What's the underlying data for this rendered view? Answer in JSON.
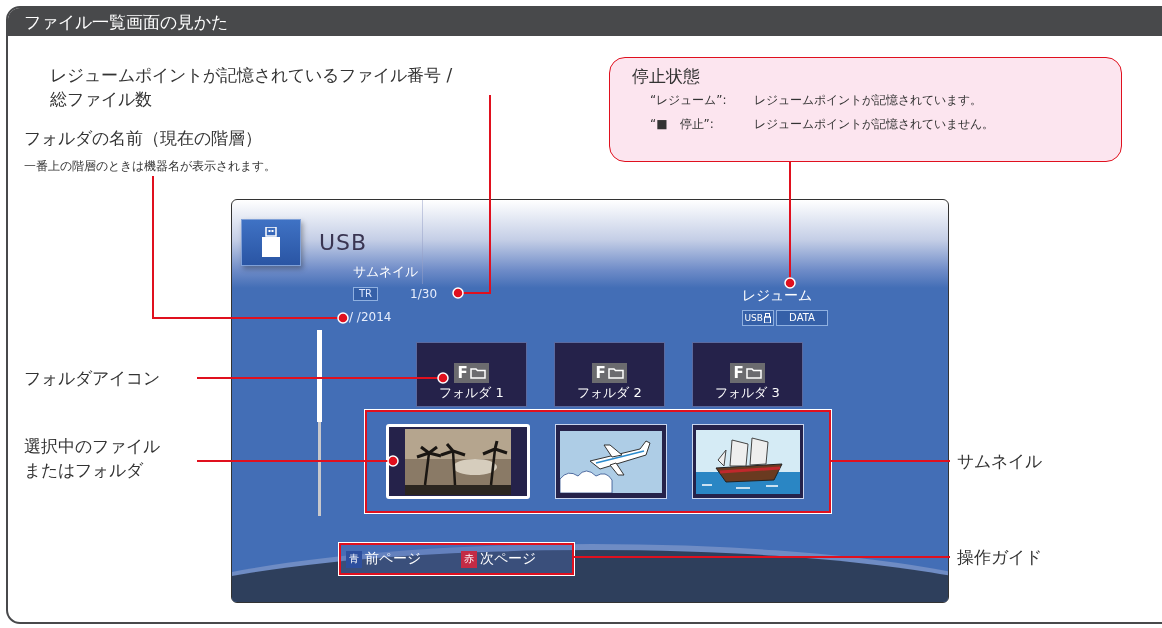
{
  "title": "ファイル一覧画面の見かた",
  "labels": {
    "resume_number": [
      "レジュームポイントが記憶されているファイル番号 /",
      "総ファイル数"
    ],
    "folder_name": "フォルダの名前（現在の階層）",
    "folder_name_note": "一番上の階層のときは機器名が表示されます。",
    "folder_icon": "フォルダアイコン",
    "selected_item": [
      "選択中のファイル",
      "またはフォルダ"
    ],
    "thumbnail": "サムネイル",
    "operation_guide": "操作ガイド"
  },
  "stop_state": {
    "title": "停止状態",
    "rows": [
      {
        "term": "“レジューム”:",
        "description": "レジュームポイントが記憶されています。"
      },
      {
        "term": "“■　停止”:",
        "description": "レジュームポイントが記憶されていません。"
      }
    ]
  },
  "screen": {
    "device": "USB",
    "view_mode": "サムネイル",
    "tr_badge": "TR",
    "file_count": "1/30",
    "path": "/ /2014",
    "resume_status": "レジューム",
    "storage_badge": "USB",
    "data_badge": "DATA",
    "folders": [
      {
        "icon_letter": "F",
        "label": "フォルダ 1"
      },
      {
        "icon_letter": "F",
        "label": "フォルダ 2"
      },
      {
        "icon_letter": "F",
        "label": "フォルダ 3"
      }
    ],
    "thumbnails": [
      {
        "kind": "photo",
        "selected": true
      },
      {
        "kind": "airplane",
        "selected": false
      },
      {
        "kind": "ship",
        "selected": false
      }
    ],
    "guide": [
      {
        "key": "青",
        "label": "前ページ",
        "color": "#2d4f9e"
      },
      {
        "key": "赤",
        "label": "次ページ",
        "color": "#c42b45"
      }
    ]
  }
}
